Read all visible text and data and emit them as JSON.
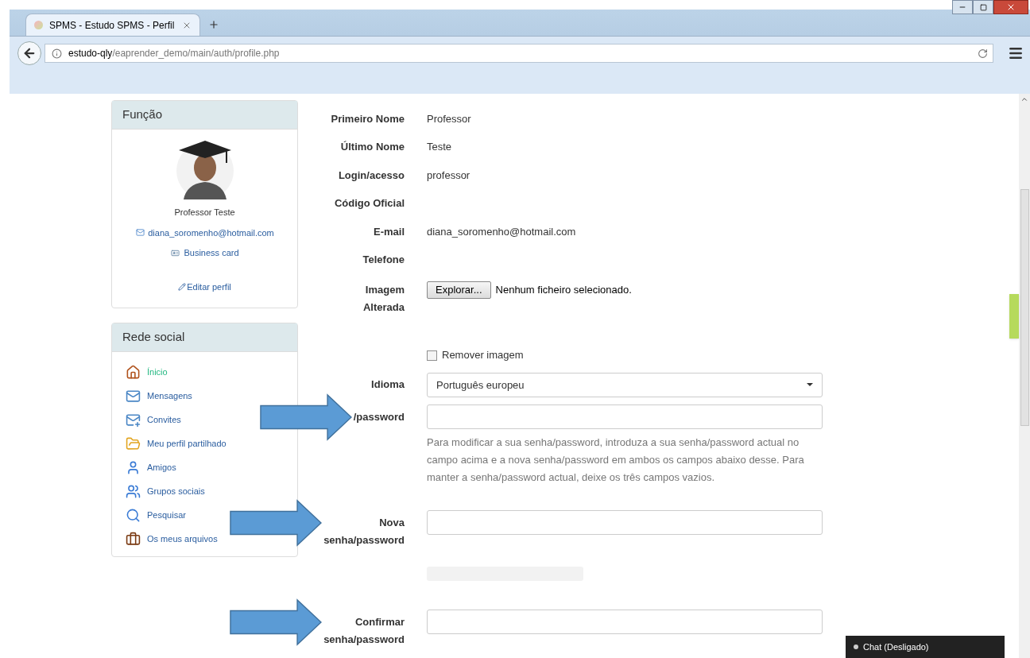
{
  "browser": {
    "tab_title": "SPMS - Estudo SPMS - Perfil",
    "url_host": "estudo-qly",
    "url_path": "/eaprender_demo/main/auth/profile.php"
  },
  "function_panel": {
    "title": "Função",
    "name": "Professor Teste",
    "email": "diana_soromenho@hotmail.com",
    "business_card": "Business card",
    "edit": "Editar perfil"
  },
  "social_panel": {
    "title": "Rede social",
    "items": [
      {
        "label": "Ínicio",
        "selected": true
      },
      {
        "label": "Mensagens",
        "selected": false
      },
      {
        "label": "Convites",
        "selected": false
      },
      {
        "label": "Meu perfil partilhado",
        "selected": false
      },
      {
        "label": "Amigos",
        "selected": false
      },
      {
        "label": "Grupos sociais",
        "selected": false
      },
      {
        "label": "Pesquisar",
        "selected": false
      },
      {
        "label": "Os meus arquivos",
        "selected": false
      }
    ]
  },
  "form": [
    {
      "kind": "text",
      "label": "Primeiro Nome",
      "value": "Professor"
    },
    {
      "kind": "text",
      "label": "Último Nome",
      "value": "Teste"
    },
    {
      "kind": "text",
      "label": "Login/acesso",
      "value": "professor"
    },
    {
      "kind": "text",
      "label": "Código Oficial"
    },
    {
      "kind": "text",
      "label": "E-mail",
      "value": "diana_soromenho@hotmail.com"
    },
    {
      "kind": "text",
      "label": "Telefone"
    },
    {
      "kind": "file",
      "label": "Imagem Alterada",
      "button": "Explorar...",
      "status": "Nenhum ficheiro selecionado."
    },
    {
      "kind": "checkbox",
      "label": "Remover imagem",
      "checked": false
    },
    {
      "kind": "select",
      "label": "Idioma",
      "value": "Português europeu"
    },
    {
      "kind": "password",
      "label": "/password",
      "annotated": true,
      "help": "Para modificar a sua senha/password, introduza a sua senha/password actual no campo acima e a nova senha/password em ambos os campos abaixo desse. Para manter a senha/password actual, deixe os três campos vazios."
    },
    {
      "kind": "password",
      "label": "Nova senha/password",
      "annotated": true
    },
    {
      "kind": "meter",
      "level": 0
    },
    {
      "kind": "password",
      "label": "Confirmar senha/password",
      "annotated": true
    }
  ],
  "chat": {
    "label": "Chat (Desligado)",
    "color": "#cccccc"
  }
}
